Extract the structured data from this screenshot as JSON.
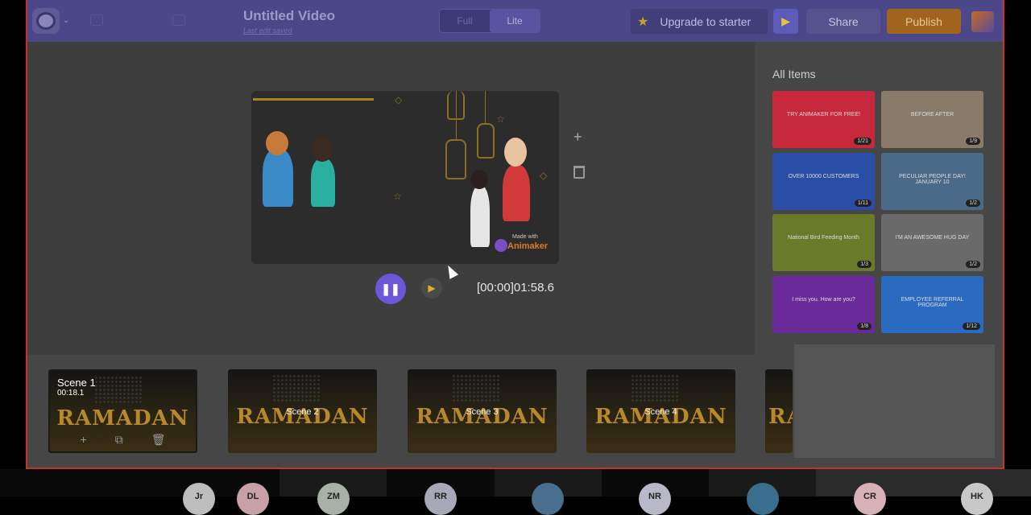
{
  "header": {
    "title": "Untitled Video",
    "subtitle": "Last edit saved",
    "toggle": [
      "Full",
      "Lite"
    ],
    "upgrade_label": "Upgrade to starter",
    "share_label": "Share",
    "publish_label": "Publish"
  },
  "player": {
    "timecode": "[00:00]01:58.6",
    "watermark_made": "Made with",
    "watermark_brand": "Animaker"
  },
  "panel": {
    "title": "All Items",
    "items": [
      {
        "text": "TRY ANIMAKER FOR FREE!",
        "badge": "1/21",
        "color": "#c8283c"
      },
      {
        "text": "BEFORE   AFTER",
        "badge": "1/9",
        "color": "#8a7a6a"
      },
      {
        "text": "OVER 10000 CUSTOMERS",
        "badge": "1/11",
        "color": "#2a4ea6"
      },
      {
        "text": "PECULIAR PEOPLE DAY! JANUARY 10",
        "badge": "1/2",
        "color": "#4a6a8a"
      },
      {
        "text": "National Bird Feeding Month",
        "badge": "1/3",
        "color": "#6a7a2a"
      },
      {
        "text": "I'M AN AWESOME HUG DAY",
        "badge": "1/2",
        "color": "#6a6a6a"
      },
      {
        "text": "I miss you. How are you?",
        "badge": "1/8",
        "color": "#6a2a9a"
      },
      {
        "text": "EMPLOYEE REFERRAL PROGRAM",
        "badge": "1/12",
        "color": "#2a6ac0"
      }
    ]
  },
  "timeline": {
    "scenes": [
      {
        "name": "Scene 1",
        "duration": "00:18.1",
        "label": ""
      },
      {
        "name": "",
        "duration": "",
        "label": "Scene 2"
      },
      {
        "name": "",
        "duration": "",
        "label": "Scene 3"
      },
      {
        "name": "",
        "duration": "",
        "label": "Scene 4"
      }
    ],
    "scene_art_text": "RAMADAN"
  },
  "taskbar": {
    "avatars": [
      "Jr",
      "DL",
      "ZM",
      "RR",
      "",
      "NR",
      "",
      "CR",
      "HK"
    ]
  }
}
